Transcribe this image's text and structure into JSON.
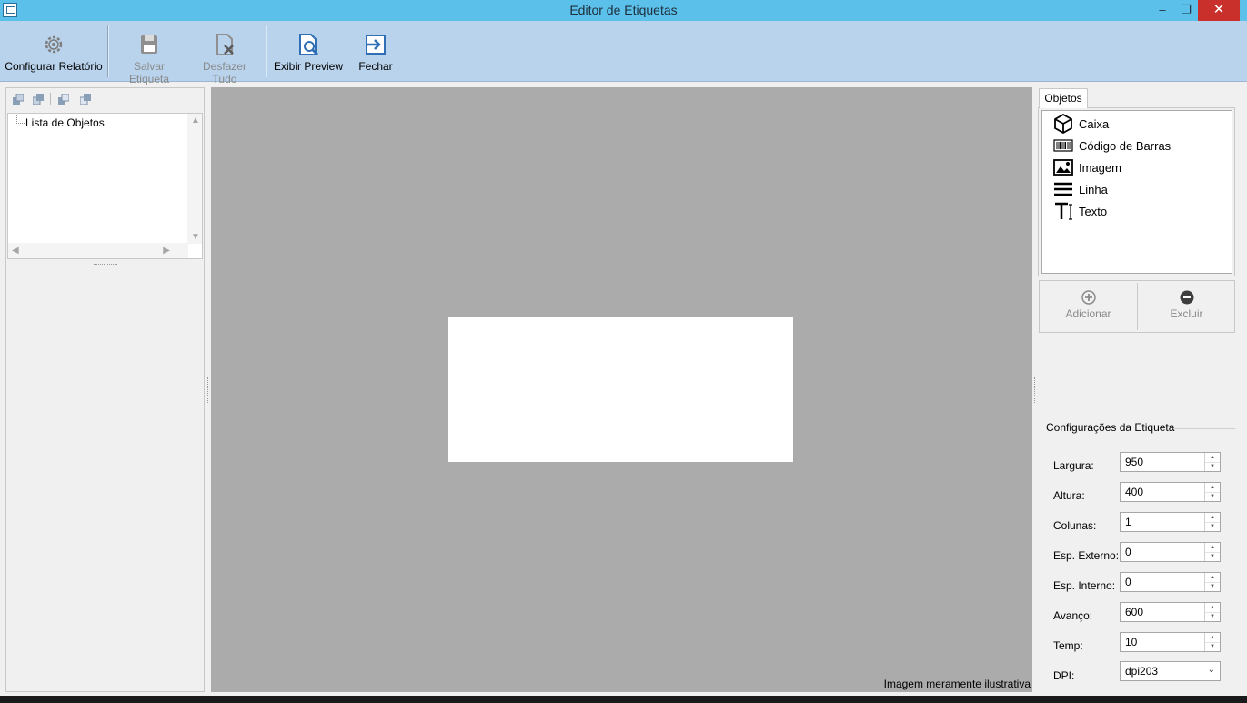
{
  "window": {
    "title": "Editor de Etiquetas",
    "minimize": "–",
    "restore": "❐",
    "close": "✕"
  },
  "toolbar": {
    "configure_report": "Configurar Relatório",
    "save_label": "Salvar Etiqueta",
    "undo_all": "Desfazer Tudo",
    "show_preview": "Exibir Preview",
    "close": "Fechar"
  },
  "left_panel": {
    "tree_root": "Lista de Objetos"
  },
  "canvas": {
    "note": "Imagem meramente ilustrativa"
  },
  "right_panel": {
    "tab_label": "Objetos",
    "objects": [
      {
        "label": "Caixa",
        "icon": "cube-icon"
      },
      {
        "label": "Código de Barras",
        "icon": "barcode-icon"
      },
      {
        "label": "Imagem",
        "icon": "image-icon"
      },
      {
        "label": "Linha",
        "icon": "lines-icon"
      },
      {
        "label": "Texto",
        "icon": "text-icon"
      }
    ],
    "add_label": "Adicionar",
    "delete_label": "Excluir",
    "settings_title": "Configurações da Etiqueta",
    "fields": {
      "largura": {
        "label": "Largura:",
        "value": "950"
      },
      "altura": {
        "label": "Altura:",
        "value": "400"
      },
      "colunas": {
        "label": "Colunas:",
        "value": "1"
      },
      "esp_externo": {
        "label": "Esp. Externo:",
        "value": "0"
      },
      "esp_interno": {
        "label": "Esp. Interno:",
        "value": "0"
      },
      "avanco": {
        "label": "Avanço:",
        "value": "600"
      },
      "temp": {
        "label": "Temp:",
        "value": "10"
      },
      "dpi": {
        "label": "DPI:",
        "value": "dpi203"
      }
    }
  },
  "colors": {
    "titlebar": "#5bc0ea",
    "toolbar": "#b9d3ec",
    "canvas": "#ababab",
    "close_button": "#c9302c"
  }
}
